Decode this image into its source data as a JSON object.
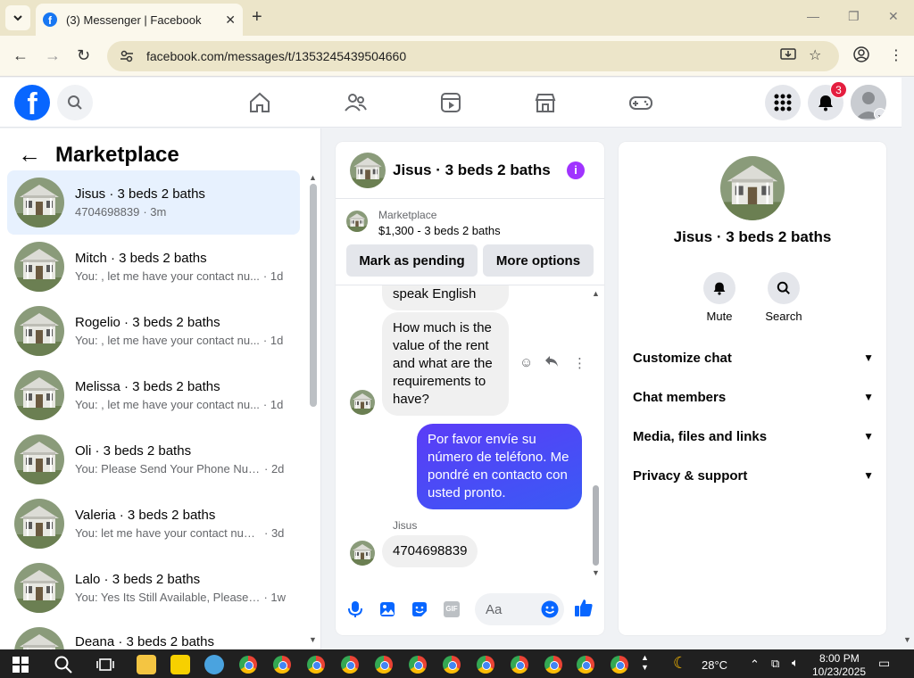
{
  "browser": {
    "tab_title": "(3) Messenger | Facebook",
    "favicon": "f",
    "url": "facebook.com/messages/t/1353245439504660"
  },
  "fbnav": {
    "logo": "f",
    "notification_count": "3"
  },
  "left": {
    "title": "Marketplace",
    "conversations": [
      {
        "name": "Jisus · 3 beds 2 baths",
        "snippet": "4704698839",
        "time": "· 3m"
      },
      {
        "name": "Mitch · 3 beds 2 baths",
        "snippet": "You: , let me have your contact nu...",
        "time": "· 1d"
      },
      {
        "name": "Rogelio · 3 beds 2 baths",
        "snippet": "You: , let me have your contact nu...",
        "time": "· 1d"
      },
      {
        "name": "Melissa · 3 beds 2 baths",
        "snippet": "You: , let me have your contact nu...",
        "time": "· 1d"
      },
      {
        "name": "Oli · 3 beds 2 baths",
        "snippet": "You: Please Send Your Phone Num...",
        "time": "· 2d"
      },
      {
        "name": "Valeria · 3 beds 2 baths",
        "snippet": "You: let me have your contact num...",
        "time": "· 3d"
      },
      {
        "name": "Lalo · 3 beds 2 baths",
        "snippet": "You: Yes Its Still Available, Please Se...",
        "time": "· 1w"
      },
      {
        "name": "Deana · 3 beds 2 baths",
        "snippet": "",
        "time": ""
      }
    ]
  },
  "chat": {
    "title": "Jisus · 3 beds 2 baths",
    "marketplace_label": "Marketplace",
    "price_line": "$1,300 - 3 beds 2 baths",
    "mark_pending": "Mark as pending",
    "more_options": "More options",
    "messages": [
      {
        "text": "speak English"
      },
      {
        "text": "How much is the value of the rent and what are the requirements to have?"
      },
      {
        "text": "Por favor envíe su número de teléfono. Me pondré en contacto con usted pronto."
      },
      {
        "sender": "Jisus",
        "text": "4704698839"
      }
    ],
    "composer_placeholder": "Aa",
    "gif_label": "GIF"
  },
  "right": {
    "name": "Jisus · 3 beds 2 baths",
    "mute": "Mute",
    "search": "Search",
    "sections": [
      "Customize chat",
      "Chat members",
      "Media, files and links",
      "Privacy & support"
    ]
  },
  "taskbar": {
    "temperature": "28°C",
    "time": "8:00 PM",
    "date": "10/23/2025"
  },
  "colors": {
    "fb_blue": "#0866ff",
    "active_conv": "#e7f1fe",
    "outgoing_bubble": "#4a4af6",
    "badge_red": "#e41e3f"
  }
}
